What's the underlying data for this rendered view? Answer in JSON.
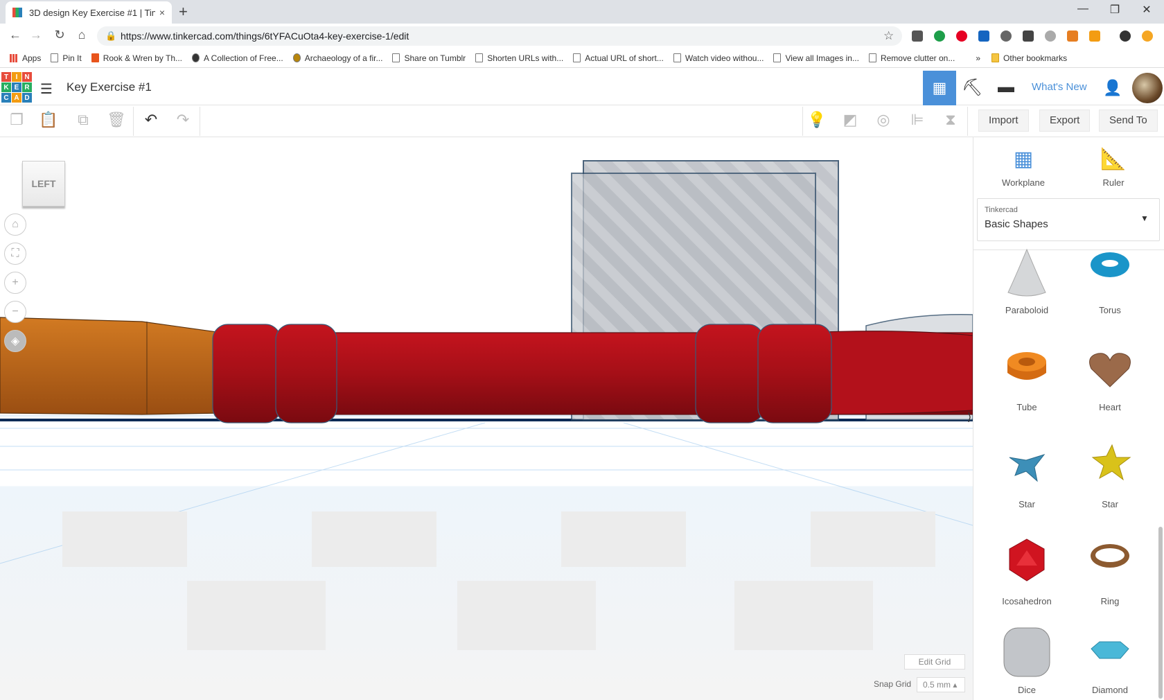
{
  "browser": {
    "tab_title": "3D design Key Exercise #1 | Tinke",
    "tab_close": "×",
    "new_tab": "+",
    "url": "https://www.tinkercad.com/things/6tYFACuOta4-key-exercise-1/edit",
    "window_min": "—",
    "window_max": "❐",
    "window_close": "✕",
    "back": "←",
    "forward": "→",
    "reload": "↻",
    "home": "⌂",
    "bookmarks": [
      "Apps",
      "Pin It",
      "Rook & Wren by Th...",
      "A Collection of Free...",
      "Archaeology of a fir...",
      "Share on Tumblr",
      "Shorten URLs with...",
      "Actual URL of short...",
      "Watch video withou...",
      "View all Images in...",
      "Remove clutter on..."
    ],
    "bookmarks_more": "»",
    "other_bookmarks": "Other bookmarks"
  },
  "app": {
    "logo_letters": [
      "T",
      "I",
      "N",
      "K",
      "E",
      "R",
      "C",
      "A",
      "D"
    ],
    "design_name": "Key Exercise #1",
    "whats_new": "What's New"
  },
  "toolbar": {
    "import": "Import",
    "export": "Export",
    "send_to": "Send To"
  },
  "viewport": {
    "view_cube_label": "LEFT",
    "edit_grid": "Edit Grid",
    "snap_grid_label": "Snap Grid",
    "snap_grid_value": "0.5 mm ▴"
  },
  "panel": {
    "workplane": "Workplane",
    "ruler": "Ruler",
    "library_source": "Tinkercad",
    "library_name": "Basic Shapes",
    "shapes": [
      "Paraboloid",
      "Torus",
      "Tube",
      "Heart",
      "Star",
      "Star",
      "Icosahedron",
      "Ring",
      "Dice",
      "Diamond"
    ]
  },
  "colors": {
    "accent": "#4a90d9",
    "key_red": "#b3111b",
    "key_orange": "#c0651a"
  }
}
